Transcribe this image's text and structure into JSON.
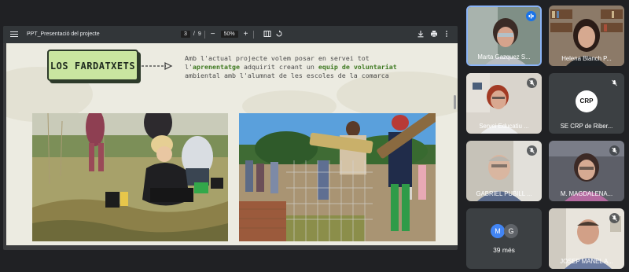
{
  "viewer": {
    "title": "PPT_Presentació del projecte",
    "page_current": "3",
    "page_sep": "/",
    "page_total": "9",
    "zoom": "50%",
    "minus": "−",
    "plus": "+"
  },
  "slide": {
    "badge": "LOS FARDATXETS",
    "line1": "Amb l'actual projecte volem posar en servei tot",
    "line2_pre": "l'",
    "line2_hl1": "aprenentatge",
    "line2_mid": " adquirit creant un ",
    "line2_hl2": "equip de voluntariat",
    "line3": "ambiental amb l'alumnat de les escoles de la comarca"
  },
  "participants": [
    {
      "name": "Marta Gazquez S...",
      "speaking": true
    },
    {
      "name": "Helena Blanch P..."
    },
    {
      "name": "Servei Educatiu ...",
      "muted": true
    },
    {
      "name": "SE CRP de Riber...",
      "muted": true,
      "logo_text": "CRP"
    },
    {
      "name": "GABRIEL PUBILL ...",
      "muted": true
    },
    {
      "name": "M. MAGDALENA...",
      "muted": true
    },
    {
      "name": "JOSEP MANEL A...",
      "muted": true
    }
  ],
  "more": {
    "label": "39 més",
    "avatars": [
      {
        "letter": "M",
        "color": "#4285f4"
      },
      {
        "letter": "G",
        "color": "#5f6368"
      }
    ]
  },
  "colors": {
    "badge_fill": "#c9e5a0",
    "highlight_green": "#3f7a22",
    "speaking_border": "#8ab4f8",
    "speaking_badge": "#1a73e8"
  }
}
